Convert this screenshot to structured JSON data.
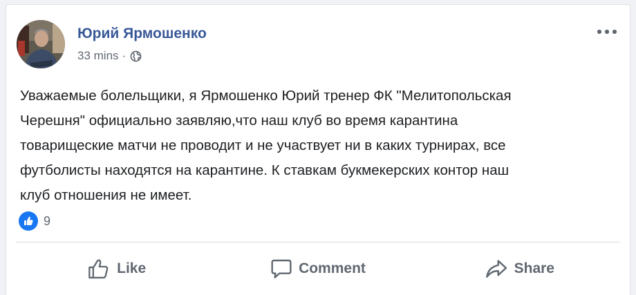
{
  "post": {
    "author": "Юрий Ярмошенко",
    "time": "33 mins",
    "separator": "·",
    "privacy_icon": "globe-icon",
    "menu_icon": "more-options-icon",
    "text": "Уважаемые болельщики, я Ярмошенко Юрий тренер ФК \"Мелитопольская\nЧерешня\" официально заявляю,что наш клуб во время карантина\nтоварищеские матчи не проводит и не участвует ни в каких турнирах, все\nфутболисты находятся на карантине. К ставкам букмекерских контор наш\nклуб отношения не имеет.",
    "reactions": {
      "icon": "like-reaction-icon",
      "count": "9"
    }
  },
  "actions": {
    "like": "Like",
    "comment": "Comment",
    "share": "Share"
  },
  "colors": {
    "author_link": "#385898",
    "secondary_text": "#606770",
    "body_text": "#1c1e21",
    "like_blue": "#1877f2",
    "divider": "#dadde1"
  }
}
